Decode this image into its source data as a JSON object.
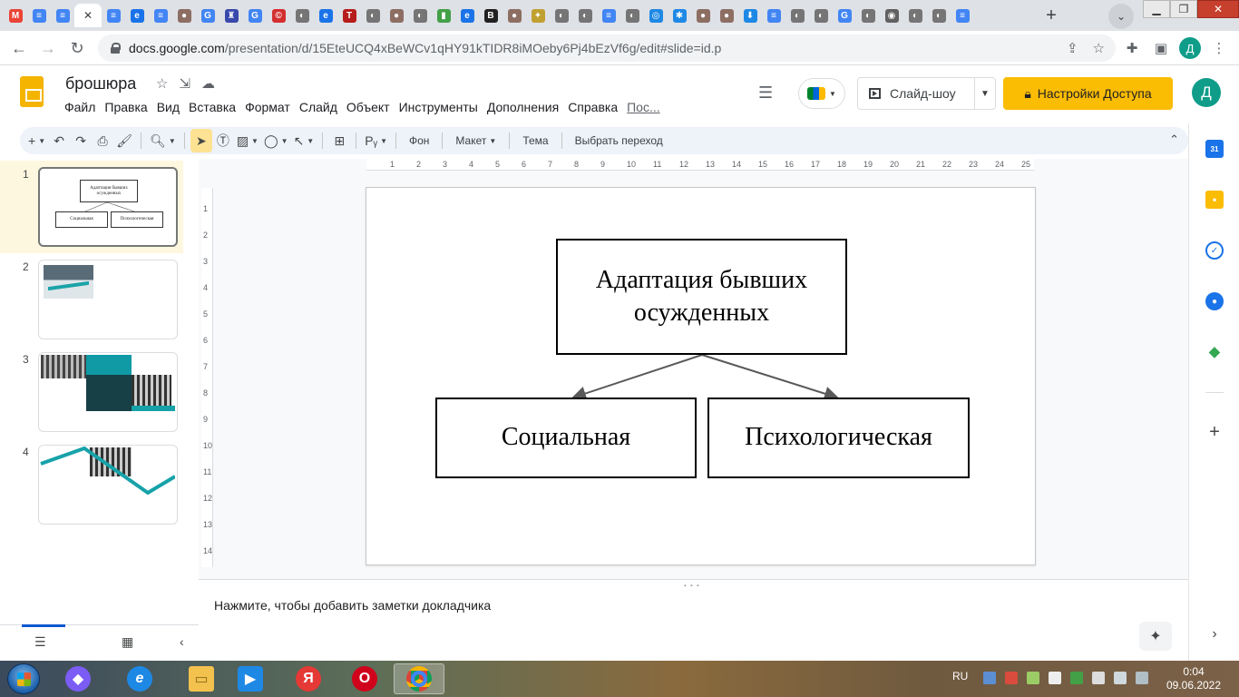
{
  "browser": {
    "tabs": [
      {
        "icon": "gmail-icon",
        "letter": "M",
        "color": "#ea4335"
      },
      {
        "icon": "docs-icon",
        "letter": "≡",
        "color": "#4285f4"
      },
      {
        "icon": "docs-icon",
        "letter": "≡",
        "color": "#4285f4"
      },
      {
        "icon": "close-tab-icon",
        "letter": "✕",
        "color": "#ffffff",
        "active": true
      },
      {
        "icon": "docs-icon",
        "letter": "≡",
        "color": "#4285f4"
      },
      {
        "icon": "edit-site-icon",
        "letter": "e",
        "color": "#1a73e8"
      },
      {
        "icon": "docs-icon",
        "letter": "≡",
        "color": "#4285f4"
      },
      {
        "icon": "avatar-site-icon",
        "letter": "●",
        "color": "#8d6e63"
      },
      {
        "icon": "google-icon",
        "letter": "G",
        "color": "#4285f4"
      },
      {
        "icon": "emblem-icon",
        "letter": "♜",
        "color": "#3949ab"
      },
      {
        "icon": "google-icon",
        "letter": "G",
        "color": "#4285f4"
      },
      {
        "icon": "copyright-site-icon",
        "letter": "©",
        "color": "#d32f2f"
      },
      {
        "icon": "globe-icon",
        "letter": "◐",
        "color": "#757575"
      },
      {
        "icon": "edit-site-icon",
        "letter": "e",
        "color": "#1a73e8"
      },
      {
        "icon": "t-site-icon",
        "letter": "T",
        "color": "#b71c1c"
      },
      {
        "icon": "globe-icon",
        "letter": "◐",
        "color": "#757575"
      },
      {
        "icon": "avatar-site-icon",
        "letter": "●",
        "color": "#8d6e63"
      },
      {
        "icon": "globe-icon",
        "letter": "◐",
        "color": "#757575"
      },
      {
        "icon": "chart-site-icon",
        "letter": "▮",
        "color": "#43a047"
      },
      {
        "icon": "edit-site-icon",
        "letter": "e",
        "color": "#1a73e8"
      },
      {
        "icon": "b-site-icon",
        "letter": "B",
        "color": "#212121"
      },
      {
        "icon": "avatar-site-icon",
        "letter": "●",
        "color": "#8d6e63"
      },
      {
        "icon": "star-site-icon",
        "letter": "✦",
        "color": "#c0a030"
      },
      {
        "icon": "globe-icon",
        "letter": "◐",
        "color": "#757575"
      },
      {
        "icon": "globe-icon",
        "letter": "◐",
        "color": "#757575"
      },
      {
        "icon": "docs-icon",
        "letter": "≡",
        "color": "#4285f4"
      },
      {
        "icon": "globe-icon",
        "letter": "◐",
        "color": "#757575"
      },
      {
        "icon": "swirl-site-icon",
        "letter": "◎",
        "color": "#1e88e5"
      },
      {
        "icon": "snowflake-site-icon",
        "letter": "✱",
        "color": "#1e88e5"
      },
      {
        "icon": "avatar-site-icon",
        "letter": "●",
        "color": "#8d6e63"
      },
      {
        "icon": "avatar-site-icon",
        "letter": "●",
        "color": "#8d6e63"
      },
      {
        "icon": "download-site-icon",
        "letter": "⬇",
        "color": "#1e88e5"
      },
      {
        "icon": "docs-icon",
        "letter": "≡",
        "color": "#4285f4"
      },
      {
        "icon": "globe-icon",
        "letter": "◐",
        "color": "#757575"
      },
      {
        "icon": "globe-icon",
        "letter": "◐",
        "color": "#757575"
      },
      {
        "icon": "google-icon",
        "letter": "G",
        "color": "#4285f4"
      },
      {
        "icon": "globe-icon",
        "letter": "◐",
        "color": "#757575"
      },
      {
        "icon": "chrome-icon",
        "letter": "◉",
        "color": "#616161"
      },
      {
        "icon": "globe-icon",
        "letter": "◐",
        "color": "#757575"
      },
      {
        "icon": "globe-icon",
        "letter": "◐",
        "color": "#757575"
      },
      {
        "icon": "docs-icon",
        "letter": "≡",
        "color": "#4285f4"
      }
    ],
    "url_host": "docs.google.com",
    "url_path": "/presentation/d/15EteUCQ4xBeWCv1qHY91kTIDR8iMOeby6Pj4bEzVf6g/edit#slide=id.p",
    "profile_letter": "Д"
  },
  "doc": {
    "title": "брошюра",
    "menu": [
      "Файл",
      "Правка",
      "Вид",
      "Вставка",
      "Формат",
      "Слайд",
      "Объект",
      "Инструменты",
      "Дополнения",
      "Справка"
    ],
    "menu_last": "Пос...",
    "slideshow_label": "Слайд-шоу",
    "share_label": "Настройки Доступа",
    "account_letter": "Д",
    "brand_color": "#f4b400",
    "share_color": "#fbbc04"
  },
  "toolbar": {
    "background": "Фон",
    "layout": "Макет",
    "theme": "Тема",
    "transition": "Выбрать переход"
  },
  "ruler": {
    "h": [
      "1",
      "2",
      "3",
      "4",
      "5",
      "6",
      "7",
      "8",
      "9",
      "10",
      "11",
      "12",
      "13",
      "14",
      "15",
      "16",
      "17",
      "18",
      "19",
      "20",
      "21",
      "22",
      "23",
      "24",
      "25"
    ],
    "v": [
      "1",
      "2",
      "3",
      "4",
      "5",
      "6",
      "7",
      "8",
      "9",
      "10",
      "11",
      "12",
      "13",
      "14"
    ]
  },
  "filmstrip": {
    "slides": [
      {
        "num": "1",
        "top_text": "Адаптация бывших осужденных",
        "left_text": "Социальная",
        "right_text": "Психологическая"
      },
      {
        "num": "2"
      },
      {
        "num": "3"
      },
      {
        "num": "4"
      }
    ]
  },
  "slide": {
    "top_box": "Адаптация бывших осужденных",
    "left_box": "Социальная",
    "right_box": "Психологическая",
    "connector_color": "#595959"
  },
  "notes": {
    "placeholder": "Нажмите, чтобы добавить заметки докладчика"
  },
  "taskbar": {
    "lang": "RU",
    "time": "0:04",
    "date": "09.06.2022"
  }
}
